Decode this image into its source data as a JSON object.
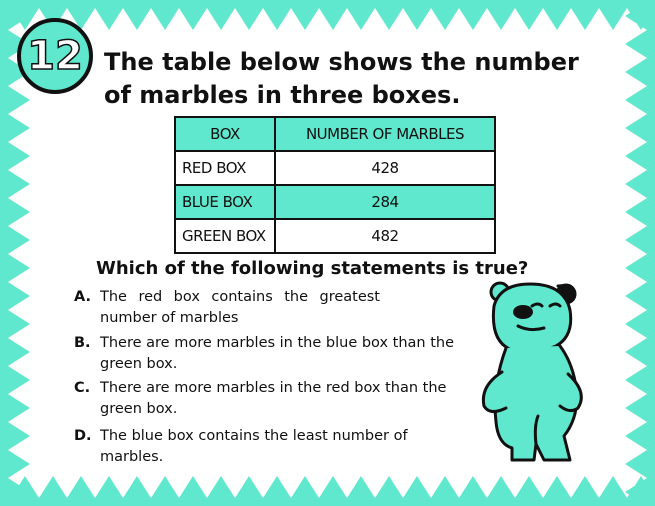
{
  "question_number": "12",
  "prompt": "The table below shows the number of marbles in three boxes.",
  "table": {
    "headers": [
      "BOX",
      "NUMBER OF MARBLES"
    ],
    "rows": [
      {
        "box": "RED BOX",
        "marbles": "428"
      },
      {
        "box": "BLUE BOX",
        "marbles": "284"
      },
      {
        "box": "GREEN BOX",
        "marbles": "482"
      }
    ]
  },
  "question": "Which of the following statements is true?",
  "options": [
    {
      "letter": "A.",
      "text": "The red box contains the greatest number of marbles"
    },
    {
      "letter": "B.",
      "text": "There are more marbles in the blue box than the green box."
    },
    {
      "letter": "C.",
      "text": "There are more marbles in the red box than the green box."
    },
    {
      "letter": "D.",
      "text": "The blue box contains the least number of marbles."
    }
  ],
  "colors": {
    "accent": "#5fe8cd",
    "ink": "#111111",
    "background": "#ffffff"
  }
}
